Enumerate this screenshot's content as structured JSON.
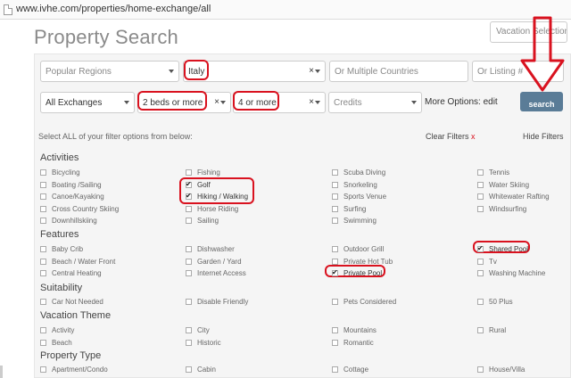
{
  "browser": {
    "url": "www.ivhe.com/properties/home-exchange/all"
  },
  "header": {
    "title": "Property Search",
    "vacation_select": "Vacation Selections"
  },
  "search": {
    "regions_placeholder": "Popular Regions",
    "country_value": "Italy",
    "countries_placeholder": "Or Multiple Countries",
    "listing_placeholder": "Or Listing #",
    "exchanges_value": "All Exchanges",
    "beds_value": "2 beds or more",
    "guests_value": "4 or more",
    "credits_placeholder": "Credits",
    "more_options": "More Options: edit",
    "search_button": "search",
    "clear_glyph": "×"
  },
  "filters": {
    "select_all_text": "Select ALL of your filter options from below:",
    "clear_filters": "Clear Filters",
    "clear_filters_x": "x",
    "hide_filters": "Hide Filters",
    "activities": {
      "title": "Activities",
      "items": [
        {
          "label": "Bicycling",
          "checked": false
        },
        {
          "label": "Fishing",
          "checked": false
        },
        {
          "label": "Scuba Diving",
          "checked": false
        },
        {
          "label": "Tennis",
          "checked": false
        },
        {
          "label": "Boating /Sailing",
          "checked": false
        },
        {
          "label": "Golf",
          "checked": true
        },
        {
          "label": "Snorkeling",
          "checked": false
        },
        {
          "label": "Water Skiing",
          "checked": false
        },
        {
          "label": "Canoe/Kayaking",
          "checked": false
        },
        {
          "label": "Hiking / Walking",
          "checked": true
        },
        {
          "label": "Sports Venue",
          "checked": false
        },
        {
          "label": "Whitewater Rafting",
          "checked": false
        },
        {
          "label": "Cross Country Skiing",
          "checked": false
        },
        {
          "label": "Horse Riding",
          "checked": false
        },
        {
          "label": "Surfing",
          "checked": false
        },
        {
          "label": "Windsurfing",
          "checked": false
        },
        {
          "label": "Downhillskiing",
          "checked": false
        },
        {
          "label": "Sailing",
          "checked": false
        },
        {
          "label": "Swimming",
          "checked": false
        }
      ]
    },
    "features": {
      "title": "Features",
      "items": [
        {
          "label": "Baby Crib",
          "checked": false
        },
        {
          "label": "Dishwasher",
          "checked": false
        },
        {
          "label": "Outdoor Grill",
          "checked": false
        },
        {
          "label": "Shared Pool",
          "checked": true
        },
        {
          "label": "Beach / Water Front",
          "checked": false
        },
        {
          "label": "Garden / Yard",
          "checked": false
        },
        {
          "label": "Private Hot Tub",
          "checked": false
        },
        {
          "label": "Tv",
          "checked": false
        },
        {
          "label": "Central Heating",
          "checked": false
        },
        {
          "label": "Internet Access",
          "checked": false
        },
        {
          "label": "Private Pool",
          "checked": true
        },
        {
          "label": "Washing Machine",
          "checked": false
        }
      ]
    },
    "suitability": {
      "title": "Suitability",
      "items": [
        {
          "label": "Car Not Needed",
          "checked": false
        },
        {
          "label": "Disable Friendly",
          "checked": false
        },
        {
          "label": "Pets Considered",
          "checked": false
        },
        {
          "label": "50 Plus",
          "checked": false
        }
      ]
    },
    "vacation_theme": {
      "title": "Vacation Theme",
      "items": [
        {
          "label": "Activity",
          "checked": false
        },
        {
          "label": "City",
          "checked": false
        },
        {
          "label": "Mountains",
          "checked": false
        },
        {
          "label": "Rural",
          "checked": false
        },
        {
          "label": "Beach",
          "checked": false
        },
        {
          "label": "Historic",
          "checked": false
        },
        {
          "label": "Romantic",
          "checked": false
        }
      ]
    },
    "property_type": {
      "title": "Property Type",
      "items": [
        {
          "label": "Apartment/Condo",
          "checked": false
        },
        {
          "label": "Cabin",
          "checked": false
        },
        {
          "label": "Cottage",
          "checked": false
        },
        {
          "label": "House/Villa",
          "checked": false
        }
      ]
    }
  },
  "colors": {
    "annotation_red": "#d9121f",
    "search_button": "#5a7c97"
  }
}
